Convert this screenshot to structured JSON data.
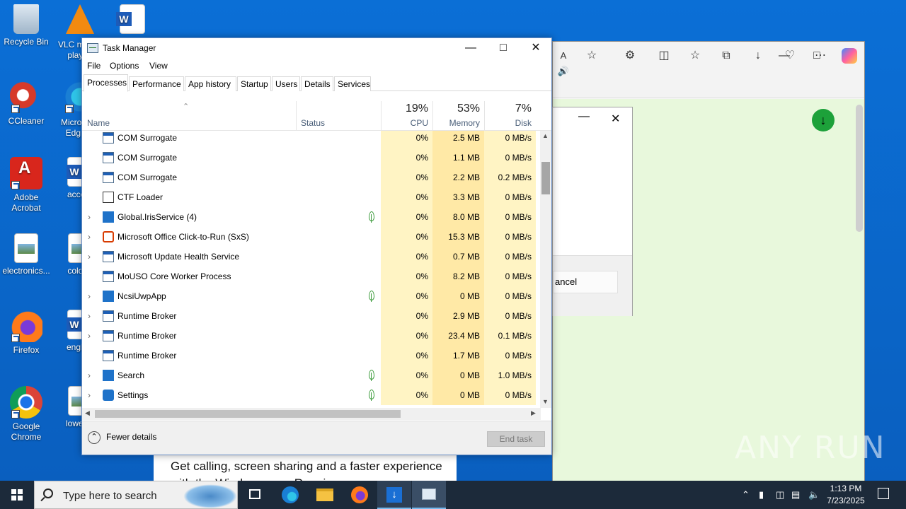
{
  "desktop": {
    "icons": [
      {
        "label": "Recycle Bin"
      },
      {
        "label": "VLC media player",
        "visible": "VLC m\nplay"
      },
      {
        "label": ""
      },
      {
        "label": "CCleaner"
      },
      {
        "label": "Micro Edge"
      },
      {
        "label": "Adobe Acrobat"
      },
      {
        "label": "accord"
      },
      {
        "label": "electronics..."
      },
      {
        "label": "colorla"
      },
      {
        "label": "Firefox"
      },
      {
        "label": "english"
      },
      {
        "label": "Google Chrome"
      },
      {
        "label": "lowests"
      }
    ]
  },
  "browser": {
    "dialog_button": "ancel",
    "page_text": "Get calling, screen sharing and a faster experience with the Windows app. Requires"
  },
  "task_manager": {
    "title": "Task Manager",
    "menu": [
      "File",
      "Options",
      "View"
    ],
    "tabs": [
      "Processes",
      "Performance",
      "App history",
      "Startup",
      "Users",
      "Details",
      "Services"
    ],
    "active_tab": "Processes",
    "columns": {
      "name": "Name",
      "status": "Status",
      "cpu": {
        "pct": "19%",
        "label": "CPU"
      },
      "memory": {
        "pct": "53%",
        "label": "Memory"
      },
      "disk": {
        "pct": "7%",
        "label": "Disk"
      }
    },
    "rows": [
      {
        "name": "COM Surrogate",
        "expandable": false,
        "eco": false,
        "cpu": "0%",
        "memory": "2.5 MB",
        "disk": "0 MB/s"
      },
      {
        "name": "COM Surrogate",
        "expandable": false,
        "eco": false,
        "cpu": "0%",
        "memory": "1.1 MB",
        "disk": "0 MB/s"
      },
      {
        "name": "COM Surrogate",
        "expandable": false,
        "eco": false,
        "cpu": "0%",
        "memory": "2.2 MB",
        "disk": "0.2 MB/s"
      },
      {
        "name": "CTF Loader",
        "expandable": false,
        "eco": false,
        "cpu": "0%",
        "memory": "3.3 MB",
        "disk": "0 MB/s"
      },
      {
        "name": "Global.IrisService (4)",
        "expandable": true,
        "eco": true,
        "cpu": "0%",
        "memory": "8.0 MB",
        "disk": "0 MB/s"
      },
      {
        "name": "Microsoft Office Click-to-Run (SxS)",
        "expandable": true,
        "eco": false,
        "cpu": "0%",
        "memory": "15.3 MB",
        "disk": "0 MB/s"
      },
      {
        "name": "Microsoft Update Health Service",
        "expandable": true,
        "eco": false,
        "cpu": "0%",
        "memory": "0.7 MB",
        "disk": "0 MB/s"
      },
      {
        "name": "MoUSO Core Worker Process",
        "expandable": false,
        "eco": false,
        "cpu": "0%",
        "memory": "8.2 MB",
        "disk": "0 MB/s"
      },
      {
        "name": "NcsiUwpApp",
        "expandable": true,
        "eco": true,
        "cpu": "0%",
        "memory": "0 MB",
        "disk": "0 MB/s"
      },
      {
        "name": "Runtime Broker",
        "expandable": true,
        "eco": false,
        "cpu": "0%",
        "memory": "2.9 MB",
        "disk": "0 MB/s"
      },
      {
        "name": "Runtime Broker",
        "expandable": true,
        "eco": false,
        "cpu": "0%",
        "memory": "23.4 MB",
        "disk": "0.1 MB/s"
      },
      {
        "name": "Runtime Broker",
        "expandable": false,
        "eco": false,
        "cpu": "0%",
        "memory": "1.7 MB",
        "disk": "0 MB/s"
      },
      {
        "name": "Search",
        "expandable": true,
        "eco": true,
        "cpu": "0%",
        "memory": "0 MB",
        "disk": "1.0 MB/s"
      },
      {
        "name": "Settings",
        "expandable": true,
        "eco": true,
        "cpu": "0%",
        "memory": "0 MB",
        "disk": "0 MB/s"
      }
    ],
    "fewer_details": "Fewer details",
    "end_task": "End task"
  },
  "taskbar": {
    "search_placeholder": "Type here to search",
    "time": "1:13 PM",
    "date": "7/23/2025"
  },
  "watermark": "ANY RUN",
  "colors": {
    "desktop": "#0a64c8",
    "cpu_bg": "#fff4c4",
    "mem_bg": "#ffe9a6",
    "disk_bg": "#fff4c4",
    "browser_bg": "#e8f8dc"
  }
}
